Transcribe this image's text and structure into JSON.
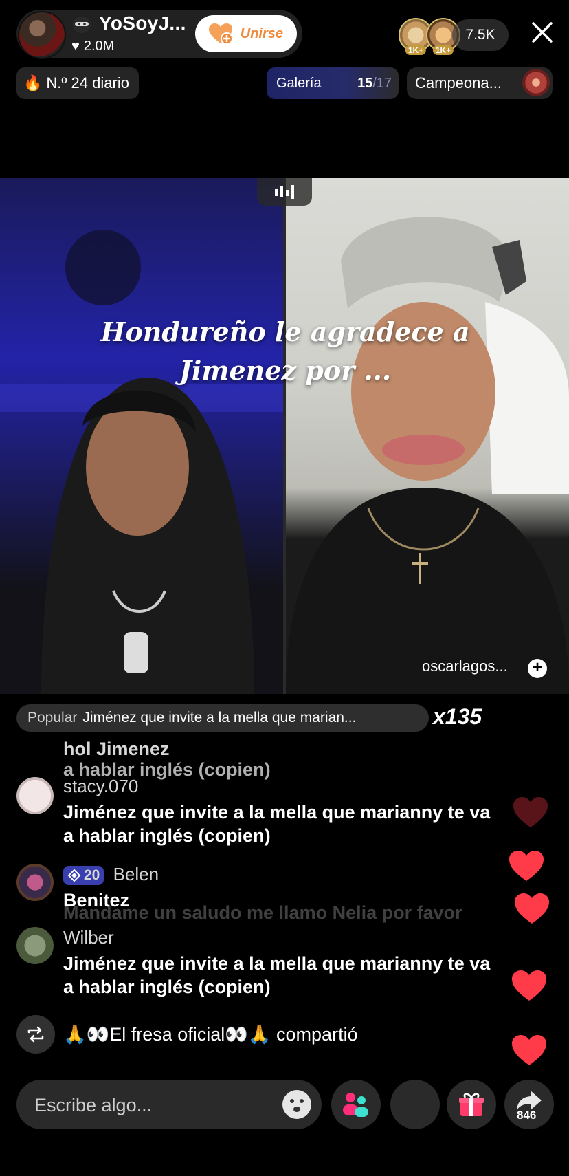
{
  "header": {
    "host_name": "YoSoyJ...",
    "host_likes": "2.0M",
    "join_label": "Unirse",
    "viewer_badges": [
      "1K+",
      "1K+"
    ],
    "viewer_count": "7.5K",
    "rank_label": "N.º 24 diario",
    "gallery_label": "Galería",
    "gallery_current": "15",
    "gallery_total": "/17",
    "championship_label": "Campeona..."
  },
  "video": {
    "overlay_title_line1": "Hondureño le agradece a",
    "overlay_title_line2": "Jimenez por ...",
    "guest_name": "oscarlagos...",
    "follow_symbol": "+"
  },
  "comments": {
    "popular_label": "Popular",
    "popular_text": "Jiménez que invite a la mella que marian...",
    "multiplier": "x135",
    "ghost_top_user": "hol Jimenez",
    "ghost_top_text": "a hablar inglés (copien)",
    "items": [
      {
        "user": "stacy.070",
        "text_line1": "Jiménez que invite a la mella que marianny te va",
        "text_line2": "a hablar inglés (copien)"
      },
      {
        "level": "20",
        "user": "Belen",
        "text_line1": "Benitez",
        "ghost_text": "Mandame un saludo me llamo Nelia por favor"
      },
      {
        "user": "Wilber",
        "text_line1": "Jiménez que invite a la mella que marianny te va",
        "text_line2": "a hablar inglés (copien)"
      }
    ],
    "share_event": "🙏👀El fresa oficial👀🙏 compartió"
  },
  "bottom_bar": {
    "input_placeholder": "Escribe algo...",
    "share_count": "846"
  },
  "colors": {
    "join_text": "#f08a3a",
    "heart": "#ff3b4a",
    "level_badge": "#3a3fb0",
    "gift": "#ff3b6b",
    "collab": "#ff2d7a"
  }
}
